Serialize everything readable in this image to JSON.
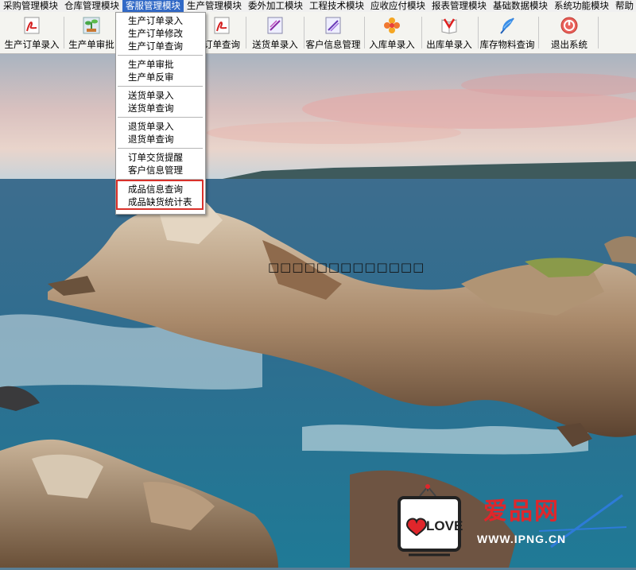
{
  "menubar": {
    "items": [
      "采购管理模块",
      "仓库管理模块",
      "客服管理模块",
      "生产管理模块",
      "委外加工模块",
      "工程技术模块",
      "应收应付模块",
      "报表管理模块",
      "基础数据模块",
      "系统功能模块",
      "帮助"
    ],
    "active_index": 2
  },
  "toolbar": {
    "buttons": [
      {
        "label": "生产订单录入",
        "icon": "pdf-icon"
      },
      {
        "label": "生产单审批",
        "icon": "plant-icon"
      },
      {
        "label": "订单查询",
        "icon": "pdf-icon"
      },
      {
        "label": "送货单录入",
        "icon": "document-icon"
      },
      {
        "label": "客户信息管理",
        "icon": "document-icon"
      },
      {
        "label": "入库单录入",
        "icon": "flower-icon"
      },
      {
        "label": "出库单录入",
        "icon": "book-icon"
      },
      {
        "label": "库存物料查询",
        "icon": "feather-icon"
      },
      {
        "label": "退出系统",
        "icon": "power-icon"
      }
    ]
  },
  "dropdown": {
    "groups": [
      [
        "生产订单录入",
        "生产订单修改",
        "生产订单查询"
      ],
      [
        "生产单审批",
        "生产单反审"
      ],
      [
        "送货单录入",
        "送货单查询"
      ],
      [
        "退货单录入",
        "退货单查询"
      ],
      [
        "订单交货提醒",
        "客户信息管理"
      ],
      [
        "成品信息查询",
        "成品缺货统计表"
      ]
    ],
    "highlighted_group": 5
  },
  "center_text": "□□□□□□□□□□□□□",
  "watermark": {
    "badge": "LOVE",
    "brand": "爱品网",
    "url": "WWW.IPNG.CN",
    "colors": {
      "red": "#e0262b",
      "blue": "#2d7bd8"
    }
  },
  "colors": {
    "menu_active": "#3169c6",
    "highlight_border": "#d9312b"
  }
}
